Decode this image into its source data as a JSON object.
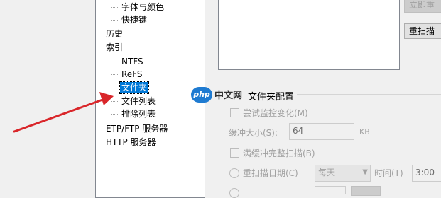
{
  "tree": {
    "items": [
      {
        "label": "字体与颜色"
      },
      {
        "label": "快捷键"
      },
      {
        "label": "历史"
      },
      {
        "label": "索引"
      },
      {
        "label": "NTFS"
      },
      {
        "label": "ReFS"
      },
      {
        "label": "文件夹"
      },
      {
        "label": "文件列表"
      },
      {
        "label": "排除列表"
      },
      {
        "label": "ETP/FTP 服务器"
      },
      {
        "label": "HTTP 服务器"
      }
    ]
  },
  "buttons": {
    "index_now": "立即重",
    "rescan": "重扫描"
  },
  "watermark": {
    "logo": "php",
    "text": "中文网"
  },
  "folder_settings": {
    "group_title": "文件夹配置",
    "monitor_changes": "尝试监控变化(M)",
    "buffer_size_label": "缓冲大小(S):",
    "buffer_size_value": "64",
    "buffer_size_unit": "KB",
    "full_rescan": "满缓冲完整扫描(B)",
    "rescan_date_label": "重扫描日期(C)",
    "rescan_date_value": "每天",
    "time_label": "时间(T)",
    "time_value": "3:00"
  },
  "colors": {
    "selection": "#0078d7",
    "arrow": "#d9262a"
  }
}
